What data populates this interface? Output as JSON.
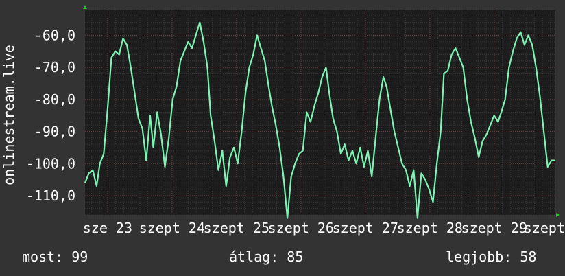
{
  "chart_data": {
    "type": "line",
    "ylabel": "onlinestream.live",
    "ylim": [
      -116,
      -52
    ],
    "yticks": [
      -60,
      -70,
      -80,
      -90,
      -100,
      -110
    ],
    "ytick_labels": [
      "-60,0",
      "-70,0",
      "-80,0",
      "-90,0",
      "-100,0",
      "-110,0"
    ],
    "xlim": [
      22.65,
      29.95
    ],
    "xticks": [
      {
        "x": 23,
        "label": "sze 23"
      },
      {
        "x": 24,
        "label": "szept 24"
      },
      {
        "x": 25,
        "label": "szept 25"
      },
      {
        "x": 26,
        "label": "szept 26"
      },
      {
        "x": 27,
        "label": "szept 27"
      },
      {
        "x": 28,
        "label": "szept 28"
      },
      {
        "x": 29,
        "label": "szept 29"
      },
      {
        "x": 30,
        "label": "szept"
      }
    ],
    "grid": true,
    "series": [
      {
        "color": "#7cf5b4",
        "x": [
          22.65,
          22.71,
          22.77,
          22.83,
          22.88,
          22.94,
          23.0,
          23.06,
          23.12,
          23.18,
          23.24,
          23.3,
          23.36,
          23.42,
          23.48,
          23.54,
          23.6,
          23.66,
          23.71,
          23.77,
          23.83,
          23.89,
          23.95,
          24.01,
          24.07,
          24.13,
          24.19,
          24.25,
          24.31,
          24.37,
          24.43,
          24.49,
          24.55,
          24.6,
          24.66,
          24.72,
          24.78,
          24.84,
          24.9,
          24.96,
          25.02,
          25.08,
          25.14,
          25.2,
          25.26,
          25.32,
          25.38,
          25.44,
          25.5,
          25.55,
          25.61,
          25.67,
          25.73,
          25.79,
          25.85,
          25.91,
          25.97,
          26.03,
          26.09,
          26.15,
          26.21,
          26.27,
          26.33,
          26.39,
          26.44,
          26.5,
          26.56,
          26.62,
          26.68,
          26.74,
          26.8,
          26.86,
          26.92,
          26.98,
          27.04,
          27.1,
          27.16,
          27.22,
          27.28,
          27.33,
          27.39,
          27.45,
          27.51,
          27.57,
          27.63,
          27.69,
          27.75,
          27.81,
          27.87,
          27.93,
          27.99,
          28.05,
          28.11,
          28.17,
          28.22,
          28.28,
          28.34,
          28.4,
          28.46,
          28.52,
          28.58,
          28.64,
          28.7,
          28.76,
          28.82,
          28.88,
          28.94,
          29.0,
          29.06,
          29.11,
          29.17,
          29.23,
          29.29,
          29.35,
          29.41,
          29.47,
          29.53,
          29.59,
          29.65,
          29.71,
          29.77,
          29.83,
          29.89,
          29.95
        ],
        "values": [
          -106,
          -103,
          -102,
          -107,
          -100,
          -97,
          -83,
          -67,
          -65,
          -66,
          -61,
          -63,
          -70,
          -78,
          -86,
          -89,
          -99,
          -85,
          -95,
          -84,
          -91,
          -101,
          -92,
          -80,
          -76,
          -68,
          -65,
          -62,
          -64,
          -60,
          -56,
          -62,
          -70,
          -85,
          -93,
          -102,
          -96,
          -107,
          -98,
          -95,
          -100,
          -90,
          -78,
          -70,
          -66,
          -60,
          -64,
          -68,
          -76,
          -82,
          -88,
          -95,
          -104,
          -117,
          -104,
          -100,
          -97,
          -96,
          -84,
          -87,
          -82,
          -78,
          -73,
          -70,
          -78,
          -86,
          -90,
          -97,
          -94,
          -99,
          -96,
          -100,
          -95,
          -101,
          -96,
          -104,
          -92,
          -80,
          -73,
          -76,
          -83,
          -90,
          -95,
          -100,
          -102,
          -107,
          -102,
          -117,
          -103,
          -105,
          -108,
          -112,
          -100,
          -90,
          -72,
          -71,
          -66,
          -64,
          -67,
          -70,
          -80,
          -87,
          -92,
          -98,
          -93,
          -91,
          -88,
          -85,
          -87,
          -84,
          -80,
          -70,
          -65,
          -61,
          -59,
          -63,
          -60,
          -63,
          -70,
          -79,
          -90,
          -101,
          -99,
          -99
        ]
      }
    ]
  },
  "stats": {
    "now": "most: 99",
    "avg": "átlag: 85",
    "best": "legjobb: 58"
  },
  "colors": {
    "background": "#333333",
    "plot_background": "#1d1d1d",
    "grid_minor": "#3a3a3a",
    "grid_major": "#6b3b3b",
    "axis_arrow": "#22cc22",
    "line": "#7cf5b4"
  }
}
